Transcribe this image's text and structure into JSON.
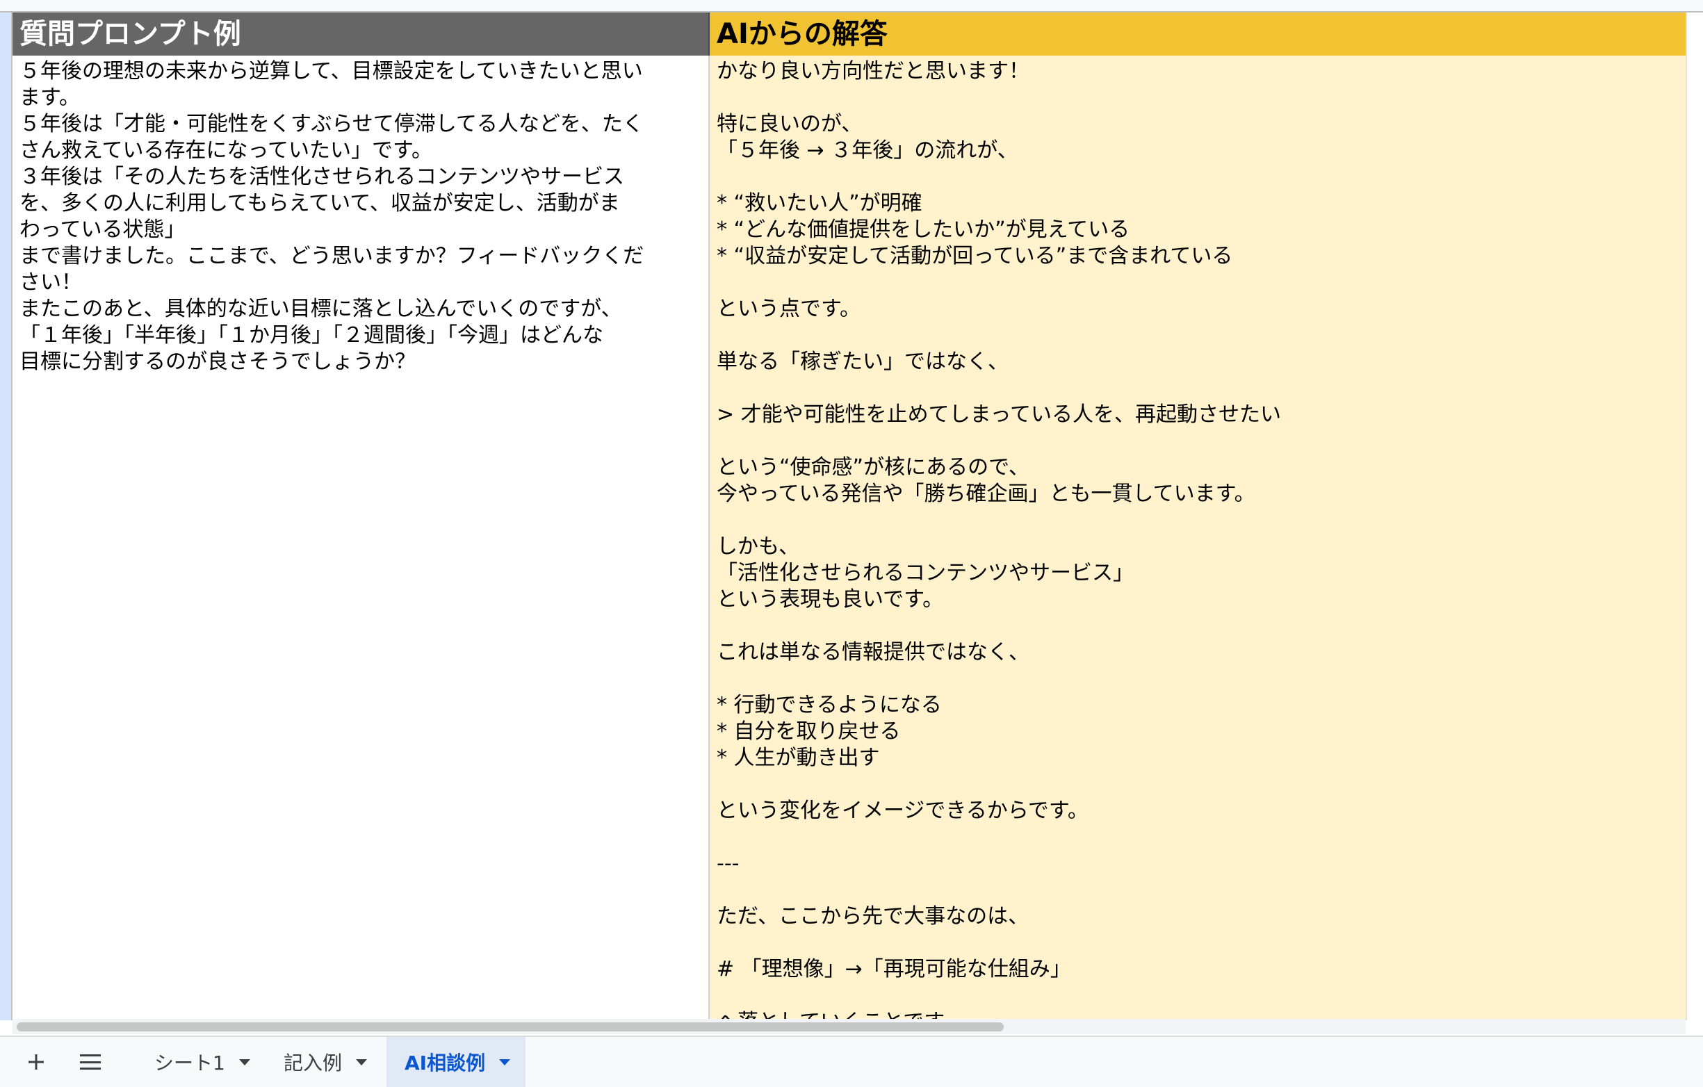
{
  "sheet": {
    "header_question": "質問プロンプト例",
    "header_answer": "AIからの解答",
    "question_lines": [
      "５年後の理想の未来から逆算して、目標設定をしていきたいと思い",
      "ます。",
      "５年後は「才能・可能性をくすぶらせて停滞してる人などを、たく",
      "さん救えている存在になっていたい」です。",
      "３年後は「その人たちを活性化させられるコンテンツやサービス",
      "を、多くの人に利用してもらえていて、収益が安定し、活動がま",
      "わっている状態」",
      "まで書けました。ここまで、どう思いますか？フィードバックくだ",
      "さい！",
      "またこのあと、具体的な近い目標に落とし込んでいくのですが、",
      "「１年後」「半年後」「１か月後」「２週間後」「今週」はどんな",
      "目標に分割するのが良さそうでしょうか？"
    ],
    "answer_lines": [
      "かなり良い方向性だと思います！",
      "",
      "特に良いのが、",
      "「５年後 → ３年後」の流れが、",
      "",
      "* “救いたい人”が明確",
      "* “どんな価値提供をしたいか”が見えている",
      "* “収益が安定して活動が回っている”まで含まれている",
      "",
      "という点です。",
      "",
      "単なる「稼ぎたい」ではなく、",
      "",
      "> 才能や可能性を止めてしまっている人を、再起動させたい",
      "",
      "という“使命感”が核にあるので、",
      "今やっている発信や「勝ち確企画」とも一貫しています。",
      "",
      "しかも、",
      "「活性化させられるコンテンツやサービス」",
      "という表現も良いです。",
      "",
      "これは単なる情報提供ではなく、",
      "",
      "* 行動できるようになる",
      "* 自分を取り戻せる",
      "* 人生が動き出す",
      "",
      "という変化をイメージできるからです。",
      "",
      "---",
      "",
      "ただ、ここから先で大事なのは、",
      "",
      "# 「理想像」→「再現可能な仕組み」",
      "",
      "へ落としていくことです。"
    ]
  },
  "toolbar": {
    "add_icon": "plus-icon",
    "list_icon": "hamburger-icon"
  },
  "tabs": [
    {
      "label": "シート1"
    },
    {
      "label": "記入例"
    },
    {
      "label": "AI相談例"
    }
  ],
  "colors": {
    "header_question_bg": "#666666",
    "header_answer_bg": "#f1c232",
    "answer_body_bg": "#fff2cc",
    "active_tab_text": "#0b57d0"
  }
}
